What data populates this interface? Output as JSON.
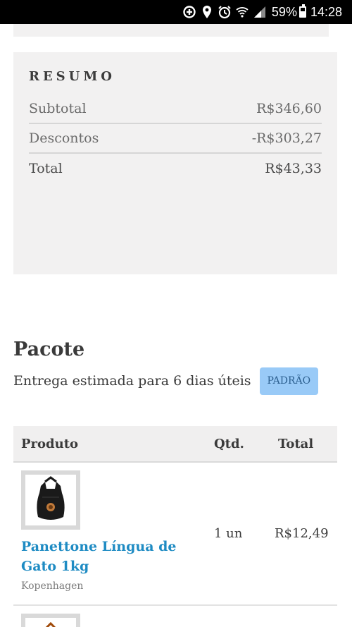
{
  "status_bar": {
    "battery_percent": "59%",
    "battery_level": 0.59,
    "time": "14:28",
    "icons": [
      "data-saver-icon",
      "location-icon",
      "alarm-icon",
      "wifi-icon",
      "signal-icon",
      "battery-icon"
    ]
  },
  "summary": {
    "title": "RESUMO",
    "rows": [
      {
        "label": "Subtotal",
        "value": "R$346,60"
      },
      {
        "label": "Descontos",
        "value": "-R$303,27"
      },
      {
        "label": "Total",
        "value": "R$43,33"
      }
    ]
  },
  "package": {
    "title": "Pacote",
    "delivery_text": "Entrega estimada para 6 dias úteis",
    "badge": "PADRÃO"
  },
  "table": {
    "headers": {
      "product": "Produto",
      "qty": "Qtd.",
      "total": "Total"
    },
    "rows": [
      {
        "name": "Panettone Língua de Gato 1kg",
        "brand": "Kopenhagen",
        "qty": "1 un",
        "total": "R$12,49"
      }
    ]
  },
  "colors": {
    "link": "#1e8bc3",
    "badge_bg": "#99caf7",
    "card_bg": "#f2f1f1"
  }
}
